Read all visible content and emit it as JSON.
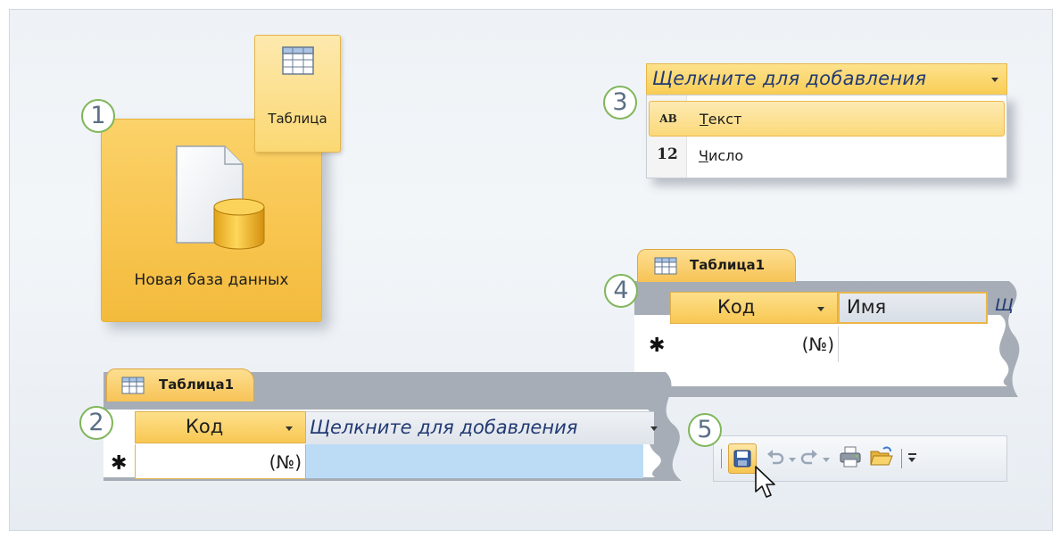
{
  "callouts": [
    "1",
    "2",
    "3",
    "4",
    "5"
  ],
  "new_database": {
    "label": "Новая база данных",
    "icon": "database-file-icon"
  },
  "table_button": {
    "label": "Таблица",
    "icon": "table-icon"
  },
  "datatype_menu": {
    "header": "Щелкните для добавления",
    "items": [
      {
        "icon_text": "AB",
        "label": "Текст",
        "selected": true
      },
      {
        "icon_text": "12",
        "label": "Число",
        "selected": false
      }
    ]
  },
  "sheet_small": {
    "tab": "Таблица1",
    "col1": "Код",
    "col2": "Щелкните для добавления",
    "new_row_marker": "✱",
    "id_value": "(№)"
  },
  "sheet_large": {
    "tab": "Таблица1",
    "col1": "Код",
    "col2": "Имя",
    "col3_partial": "Щ",
    "new_row_marker": "✱",
    "id_value": "(№)"
  },
  "quick_access": {
    "buttons": [
      "save-icon",
      "undo-icon",
      "redo-icon",
      "print-icon",
      "open-folder-icon",
      "customize-icon"
    ]
  },
  "colors": {
    "accent_orange": "#f8c54f",
    "callout_ring": "#7fb65a",
    "header_italic_text": "#223a73",
    "selection_blue": "#bcdcf6"
  }
}
